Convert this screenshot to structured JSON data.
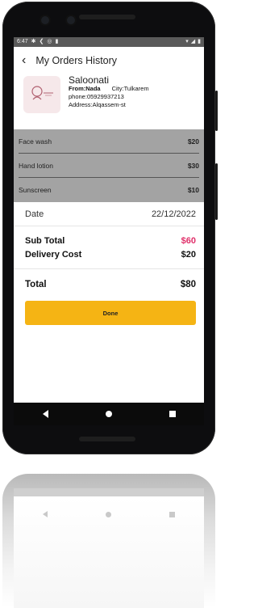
{
  "status_bar": {
    "time": "6:47",
    "icons_left": [
      "settings-icon",
      "share-icon",
      "whatsapp-icon",
      "clipboard-icon"
    ],
    "icons_right": [
      "wifi-icon",
      "signal-icon",
      "battery-icon"
    ]
  },
  "app_bar": {
    "title": "My Orders History"
  },
  "shop": {
    "name": "Saloonati",
    "from_label": "From:",
    "from_value": "Nada",
    "city": "City:Tulkarem",
    "phone": "phone:05929937213",
    "address": "Address:Alqassem-st"
  },
  "items": [
    {
      "name": "Face wash",
      "price": "$20"
    },
    {
      "name": "Hand lotion",
      "price": "$30"
    },
    {
      "name": "Sunscreen",
      "price": "$10"
    }
  ],
  "date": {
    "label": "Date",
    "value": "22/12/2022"
  },
  "summary": {
    "subtotal_label": "Sub Total",
    "subtotal_value": "$60",
    "delivery_label": "Delivery Cost",
    "delivery_value": "$20",
    "total_label": "Total",
    "total_value": "$80"
  },
  "done_button": {
    "label": "Done"
  },
  "colors": {
    "accent": "#f5b414",
    "subtotal": "#e0306a",
    "items_bg": "#a3a3a3"
  }
}
